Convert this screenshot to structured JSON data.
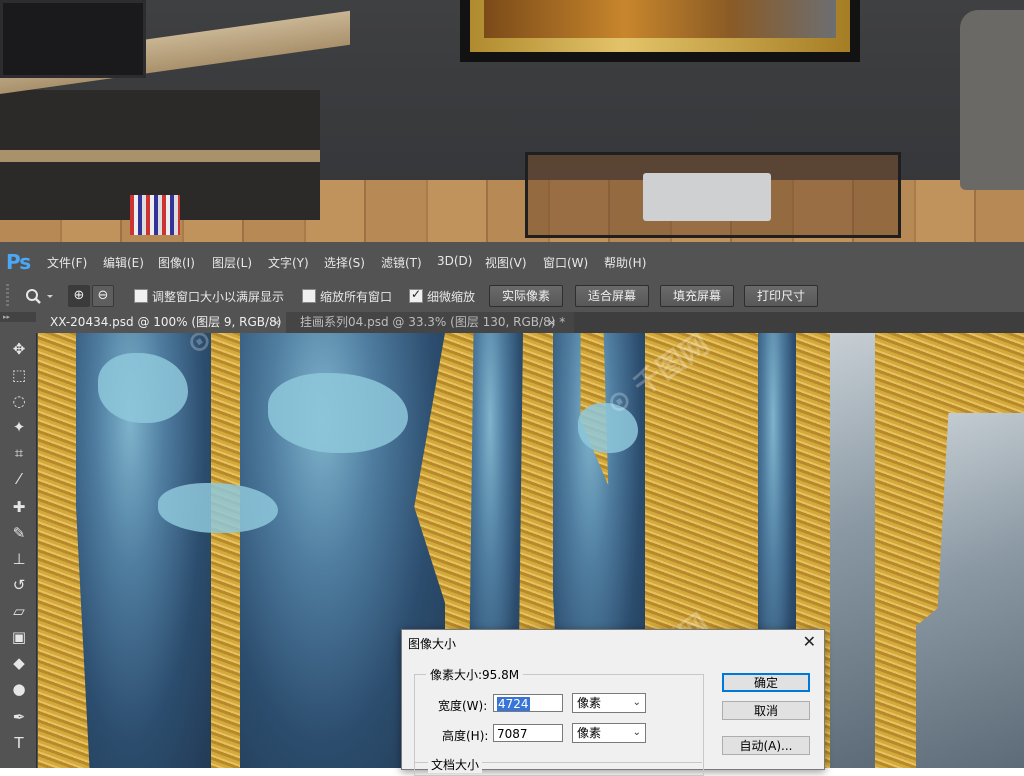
{
  "app": {
    "logo": "Ps",
    "logo_color": "#4aa8f7",
    "menu": [
      "文件(F)",
      "编辑(E)",
      "图像(I)",
      "图层(L)",
      "文字(Y)",
      "选择(S)",
      "滤镜(T)",
      "3D(D)",
      "视图(V)",
      "窗口(W)",
      "帮助(H)"
    ]
  },
  "options_bar": {
    "tool_icon": "magnifier-icon",
    "zoom_in": "⊕",
    "zoom_out": "⊖",
    "checkboxes": [
      {
        "label": "调整窗口大小以满屏显示",
        "checked": false
      },
      {
        "label": "缩放所有窗口",
        "checked": false
      },
      {
        "label": "细微缩放",
        "checked": true
      }
    ],
    "buttons": [
      "实际像素",
      "适合屏幕",
      "填充屏幕",
      "打印尺寸"
    ]
  },
  "tabs": [
    {
      "label": "XX-20434.psd @ 100% (图层 9, RGB/8)",
      "close": "×",
      "active": true
    },
    {
      "label": "挂画系列04.psd @ 33.3% (图层 130, RGB/8) *",
      "close": "×",
      "active": false
    }
  ],
  "toolbox": {
    "header": "▸▸",
    "tools": [
      "move-tool-icon",
      "marquee-tool-icon",
      "lasso-tool-icon",
      "magic-wand-icon",
      "crop-tool-icon",
      "eyedropper-icon",
      "healing-brush-icon",
      "brush-tool-icon",
      "clone-stamp-icon",
      "history-brush-icon",
      "eraser-icon",
      "gradient-tool-icon",
      "blur-tool-icon",
      "dodge-tool-icon",
      "pen-tool-icon",
      "type-tool-icon"
    ]
  },
  "dialog": {
    "title": "图像大小",
    "close": "✕",
    "pixel_dimensions_label": "像素大小:95.8M",
    "width_label": "宽度(W):",
    "width_value": "4724",
    "width_unit": "像素",
    "height_label": "高度(H):",
    "height_value": "7087",
    "height_unit": "像素",
    "document_size_label": "文档大小",
    "buttons": {
      "ok": "确定",
      "cancel": "取消",
      "auto": "自动(A)..."
    }
  },
  "colors": {
    "ps_panel": "#535353",
    "accent_selection": "#3875d7",
    "gold": "#d4a93c",
    "navy": "#2c4d6e"
  }
}
